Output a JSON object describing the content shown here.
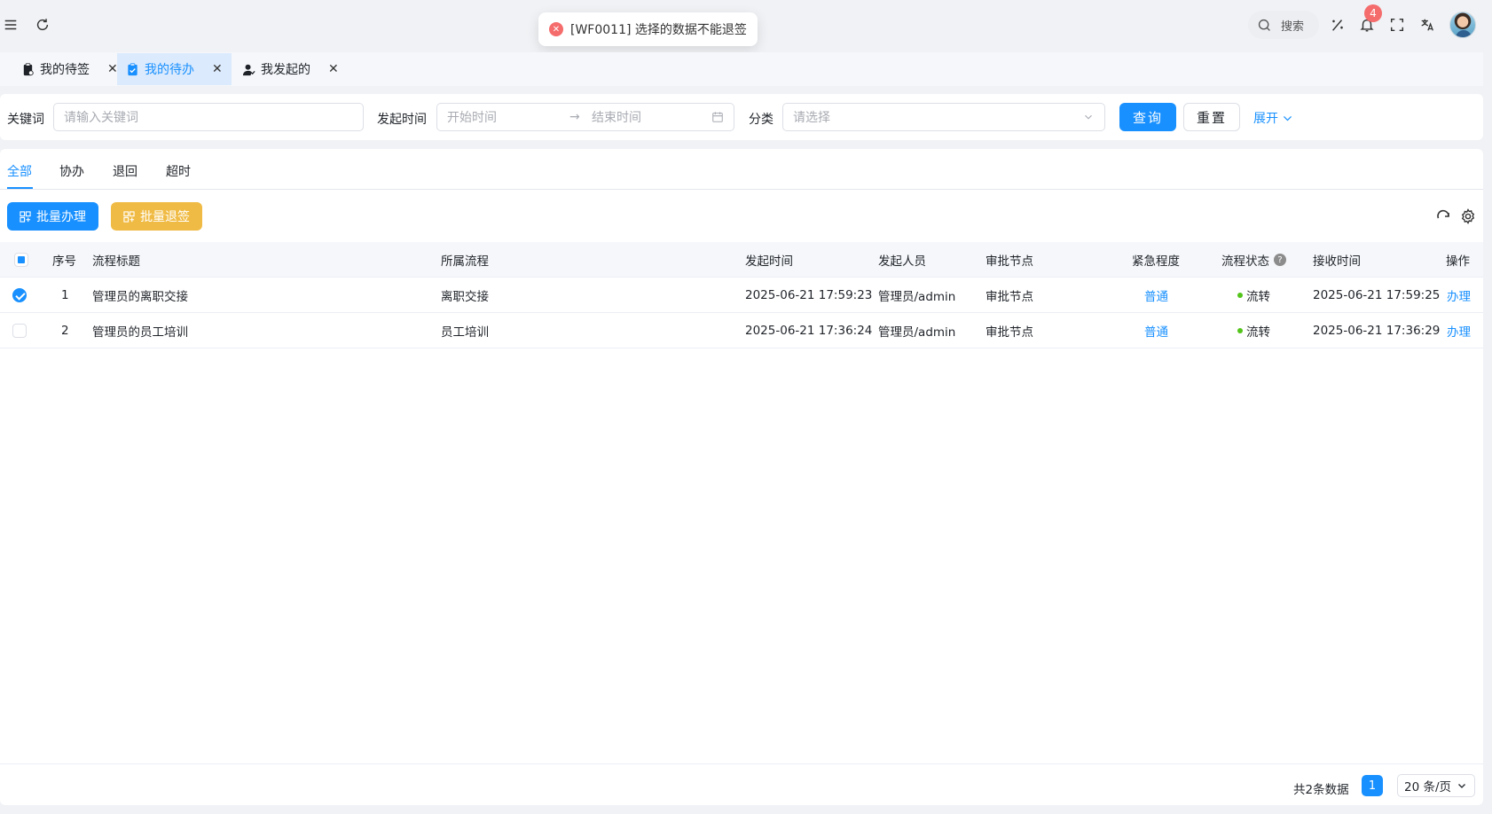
{
  "header": {
    "search_label": "搜索",
    "notification_count": "4"
  },
  "toast": {
    "icon": "close-circle-icon",
    "message": "[WF0011] 选择的数据不能退签",
    "color": "#f56c6c"
  },
  "tabs": [
    {
      "label": "我的待签",
      "icon": "clipboard-icon",
      "active": false
    },
    {
      "label": "我的待办",
      "icon": "clipboard-check-icon",
      "active": true
    },
    {
      "label": "我发起的",
      "icon": "user-icon",
      "active": false
    }
  ],
  "filters": {
    "keyword_label": "关键词",
    "keyword_placeholder": "请输入关键词",
    "time_label": "发起时间",
    "start_placeholder": "开始时间",
    "range_separator": "→",
    "end_placeholder": "结束时间",
    "category_label": "分类",
    "category_placeholder": "请选择",
    "query_button": "查询",
    "reset_button": "重置",
    "expand_link": "展开"
  },
  "subtabs": [
    "全部",
    "协办",
    "退回",
    "超时"
  ],
  "actions": {
    "batch_handle": "批量办理",
    "batch_return": "批量退签"
  },
  "table": {
    "columns": {
      "index": "序号",
      "title": "流程标题",
      "process": "所属流程",
      "start_time": "发起时间",
      "initiator": "发起人员",
      "node": "审批节点",
      "urgency": "紧急程度",
      "status": "流程状态",
      "received": "接收时间",
      "operation": "操作"
    },
    "rows": [
      {
        "index": "1",
        "title": "管理员的离职交接",
        "process": "离职交接",
        "start_time": "2025-06-21 17:59:23",
        "initiator": "管理员/admin",
        "node": "审批节点",
        "urgency": "普通",
        "status": "流转",
        "received": "2025-06-21 17:59:25",
        "operation": "办理",
        "checked": true
      },
      {
        "index": "2",
        "title": "管理员的员工培训",
        "process": "员工培训",
        "start_time": "2025-06-21 17:36:24",
        "initiator": "管理员/admin",
        "node": "审批节点",
        "urgency": "普通",
        "status": "流转",
        "received": "2025-06-21 17:36:29",
        "operation": "办理",
        "checked": false
      }
    ]
  },
  "pagination": {
    "total_text": "共2条数据",
    "current_page": "1",
    "page_size": "20 条/页"
  },
  "colors": {
    "primary": "#1890ff",
    "warning": "#f0bb45",
    "status_green": "#52c41a",
    "error": "#f56c6c"
  }
}
